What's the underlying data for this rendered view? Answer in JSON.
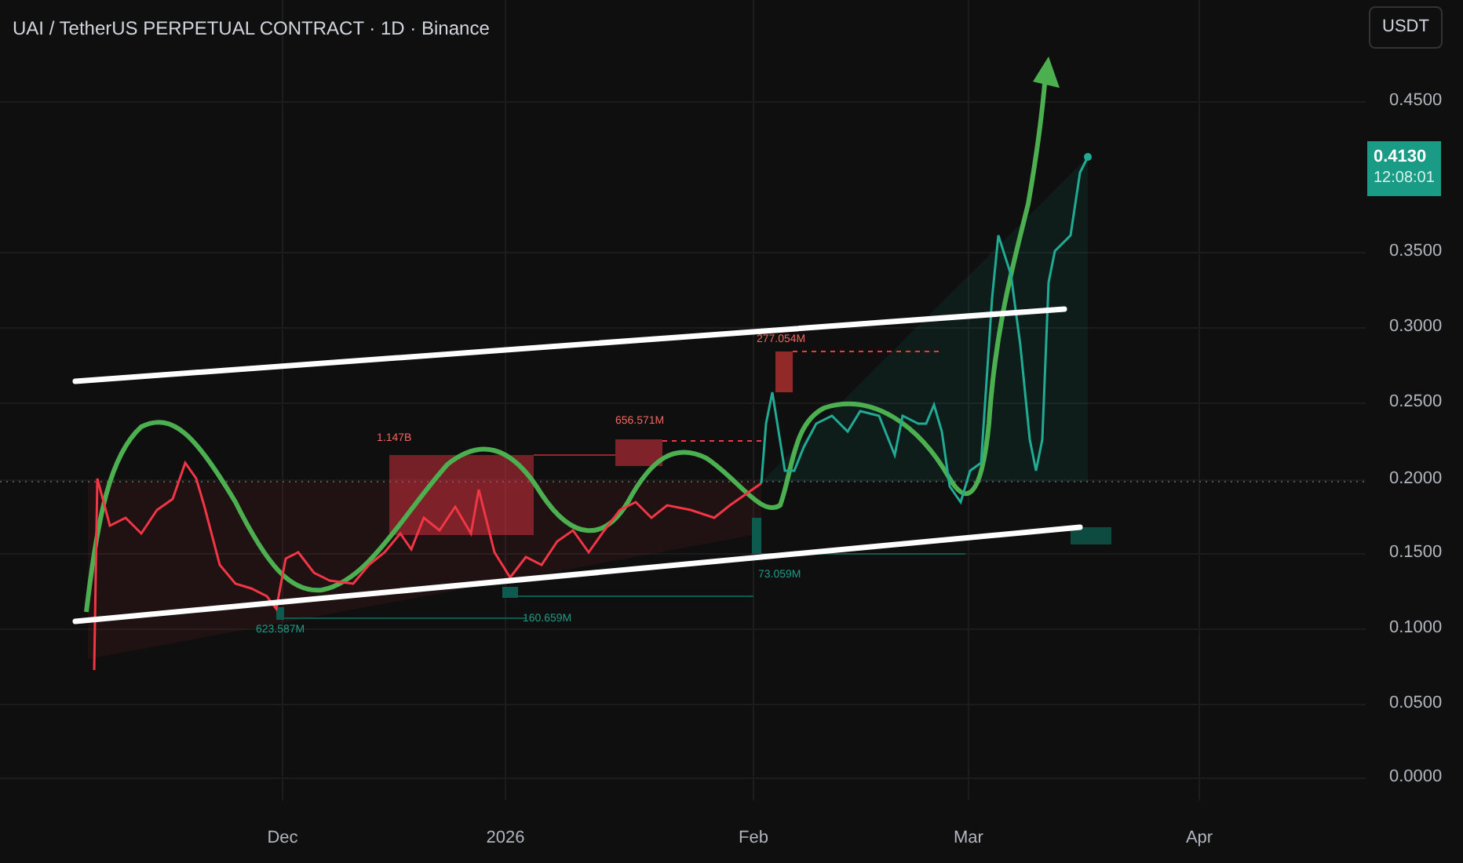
{
  "title": "UAI / TetherUS PERPETUAL CONTRACT · 1D · Binance",
  "currency_button": "USDT",
  "price_axis": [
    "0.4500",
    "0.3500",
    "0.3000",
    "0.2500",
    "0.2000",
    "0.1500",
    "0.1000",
    "0.0500",
    "0.0000"
  ],
  "last_price": {
    "price": "0.4130",
    "countdown": "12:08:01"
  },
  "time_axis": [
    "Dec",
    "2026",
    "Feb",
    "Mar",
    "Apr"
  ],
  "volume_labels": [
    {
      "text": "1.147B",
      "kind": "sell"
    },
    {
      "text": "656.571M",
      "kind": "sell"
    },
    {
      "text": "277.054M",
      "kind": "sell"
    },
    {
      "text": "623.587M",
      "kind": "buy"
    },
    {
      "text": "160.659M",
      "kind": "buy"
    },
    {
      "text": "73.059M",
      "kind": "buy"
    }
  ]
}
